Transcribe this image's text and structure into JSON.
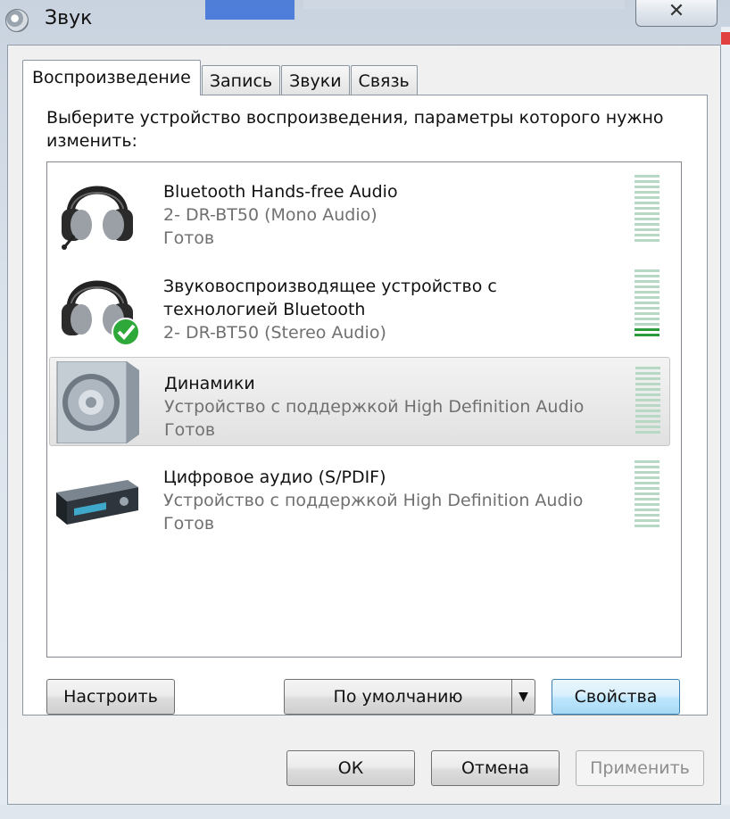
{
  "window": {
    "title": "Звук",
    "close_glyph": "✕"
  },
  "tabs": [
    {
      "label": "Воспроизведение",
      "active": true
    },
    {
      "label": "Запись",
      "active": false
    },
    {
      "label": "Звуки",
      "active": false
    },
    {
      "label": "Связь",
      "active": false
    }
  ],
  "instruction": "Выберите устройство воспроизведения, параметры которого нужно изменить:",
  "devices": [
    {
      "name": "Bluetooth Hands-free Audio",
      "name2": "",
      "desc": "2- DR-BT50 (Mono Audio)",
      "status": "Готов",
      "icon": "headset-mic-icon",
      "default": false,
      "level_bars_lit": 0
    },
    {
      "name": "Звуковоспроизводящее устройство с",
      "name2": "технологией Bluetooth",
      "desc": "2- DR-BT50 (Stereo Audio)",
      "status": "",
      "icon": "headphones-icon",
      "default": true,
      "level_bars_lit": 2
    },
    {
      "name": "Динамики",
      "name2": "",
      "desc": "Устройство с поддержкой High Definition Audio",
      "status": "Готов",
      "icon": "speaker-icon",
      "default": false,
      "selected": true,
      "level_bars_lit": 0
    },
    {
      "name": "Цифровое аудио (S/PDIF)",
      "name2": "",
      "desc": "Устройство с поддержкой High Definition Audio",
      "status": "Готов",
      "icon": "digital-receiver-icon",
      "default": false,
      "level_bars_lit": 0
    }
  ],
  "buttons": {
    "configure": "Настроить",
    "set_default": "По умолчанию",
    "properties": "Свойства",
    "ok": "ОК",
    "cancel": "Отмена",
    "apply": "Применить"
  },
  "colors": {
    "meter_off": "#b8d8c6",
    "meter_on": "#2a9a3a",
    "default_check": "#2fa83a"
  }
}
